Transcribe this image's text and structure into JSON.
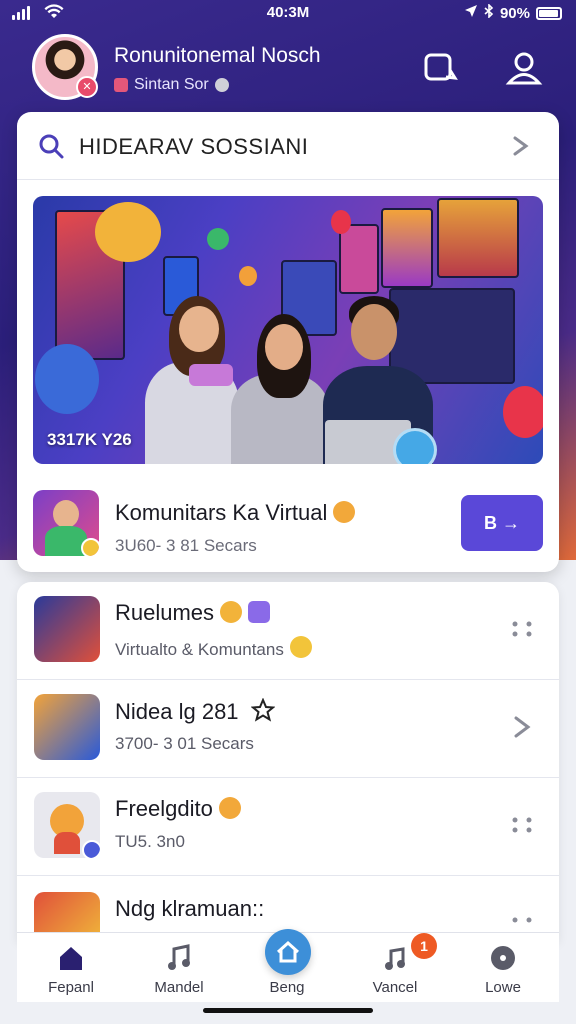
{
  "status_bar": {
    "time": "40:3M",
    "battery": "90%"
  },
  "header": {
    "user_name": "Ronunitonemal Nosch",
    "user_status": "Sintan Sor"
  },
  "search": {
    "value": "HIDEARAV SOSSIANI"
  },
  "banner": {
    "count_label": "3317K Y26"
  },
  "featured": {
    "title": "Komunitars Ka Virtual",
    "subtitle": "3U60- 3 81 Secars",
    "button_label": "B →"
  },
  "list": [
    {
      "title": "Ruelumes",
      "subtitle": "Virtualto & Komuntans",
      "action_icon": "more-icon"
    },
    {
      "title": "Nidea lg 281",
      "subtitle": "3700- 3 01 Secars",
      "action_icon": "chevron-right-icon"
    },
    {
      "title": "Freelgdito",
      "subtitle": "TU5. 3n0",
      "action_icon": "more-icon"
    },
    {
      "title": "Ndg klramuan::",
      "subtitle": "",
      "action_icon": "more-icon"
    }
  ],
  "tabs": [
    {
      "label": "Fepanl",
      "icon": "home-icon"
    },
    {
      "label": "Mandel",
      "icon": "music-icon"
    },
    {
      "label": "Beng",
      "icon": "house-icon"
    },
    {
      "label": "Vancel",
      "icon": "music-note-icon",
      "badge": "1"
    },
    {
      "label": "Lowe",
      "icon": "circle-icon"
    }
  ],
  "colors": {
    "accent": "#5a48d8",
    "header_bg": "#2b1f7a",
    "badge": "#ee5a24",
    "home_tab": "#3d8fd8"
  }
}
